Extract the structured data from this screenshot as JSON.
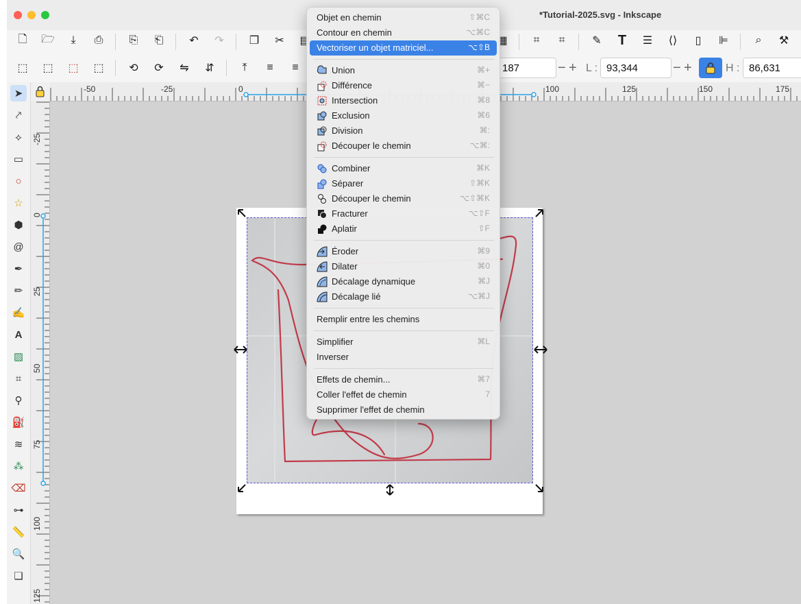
{
  "window": {
    "title": "*Tutorial-2025.svg - Inkscape"
  },
  "toolbar2": {
    "x_value_partial": "187",
    "l_label": "L :",
    "l_value": "93,344",
    "h_label": "H :",
    "h_value": "86,631",
    "minus": "−",
    "plus": "+"
  },
  "ruler": {
    "h_labels": [
      "-50",
      "-25",
      "0",
      "100",
      "125",
      "150",
      "175"
    ],
    "v_labels": [
      "-25",
      "0",
      "25",
      "50",
      "75",
      "100",
      "125"
    ]
  },
  "menu": {
    "items": [
      {
        "label": "Objet en chemin",
        "shortcut": "⇧⌘C"
      },
      {
        "label": "Contour en chemin",
        "shortcut": "⌥⌘C"
      },
      {
        "label": "Vectoriser un objet matriciel...",
        "shortcut": "⌥⇧B"
      },
      {
        "label": "Union",
        "shortcut": "⌘+"
      },
      {
        "label": "Différence",
        "shortcut": "⌘−"
      },
      {
        "label": "Intersection",
        "shortcut": "⌘8"
      },
      {
        "label": "Exclusion",
        "shortcut": "⌘6"
      },
      {
        "label": "Division",
        "shortcut": "⌘:"
      },
      {
        "label": "Découper le chemin",
        "shortcut": "⌥⌘:"
      },
      {
        "label": "Combiner",
        "shortcut": "⌘K"
      },
      {
        "label": "Séparer",
        "shortcut": "⇧⌘K"
      },
      {
        "label": "Découper le chemin",
        "shortcut": "⌥⇧⌘K"
      },
      {
        "label": "Fracturer",
        "shortcut": "⌥⇧F"
      },
      {
        "label": "Aplatir",
        "shortcut": "⇧F"
      },
      {
        "label": "Éroder",
        "shortcut": "⌘9"
      },
      {
        "label": "Dilater",
        "shortcut": "⌘0"
      },
      {
        "label": "Décalage dynamique",
        "shortcut": "⌘J"
      },
      {
        "label": "Décalage lié",
        "shortcut": "⌥⌘J"
      },
      {
        "label": "Remplir entre les chemins",
        "shortcut": ""
      },
      {
        "label": "Simplifier",
        "shortcut": "⌘L"
      },
      {
        "label": "Inverser",
        "shortcut": ""
      },
      {
        "label": "Effets de chemin...",
        "shortcut": "⌘7"
      },
      {
        "label": "Coller l'effet de chemin",
        "shortcut": "7"
      },
      {
        "label": "Supprimer l'effet de chemin",
        "shortcut": ""
      }
    ],
    "highlighted_index": 2,
    "highlight_color": "#3b82e6"
  },
  "colors": {
    "accent": "#3b82e6",
    "close": "#ff5f57",
    "minimize": "#febc2e",
    "zoom": "#28c840",
    "guide": "#2aa3e8",
    "pen_stroke": "#c23a4a"
  }
}
